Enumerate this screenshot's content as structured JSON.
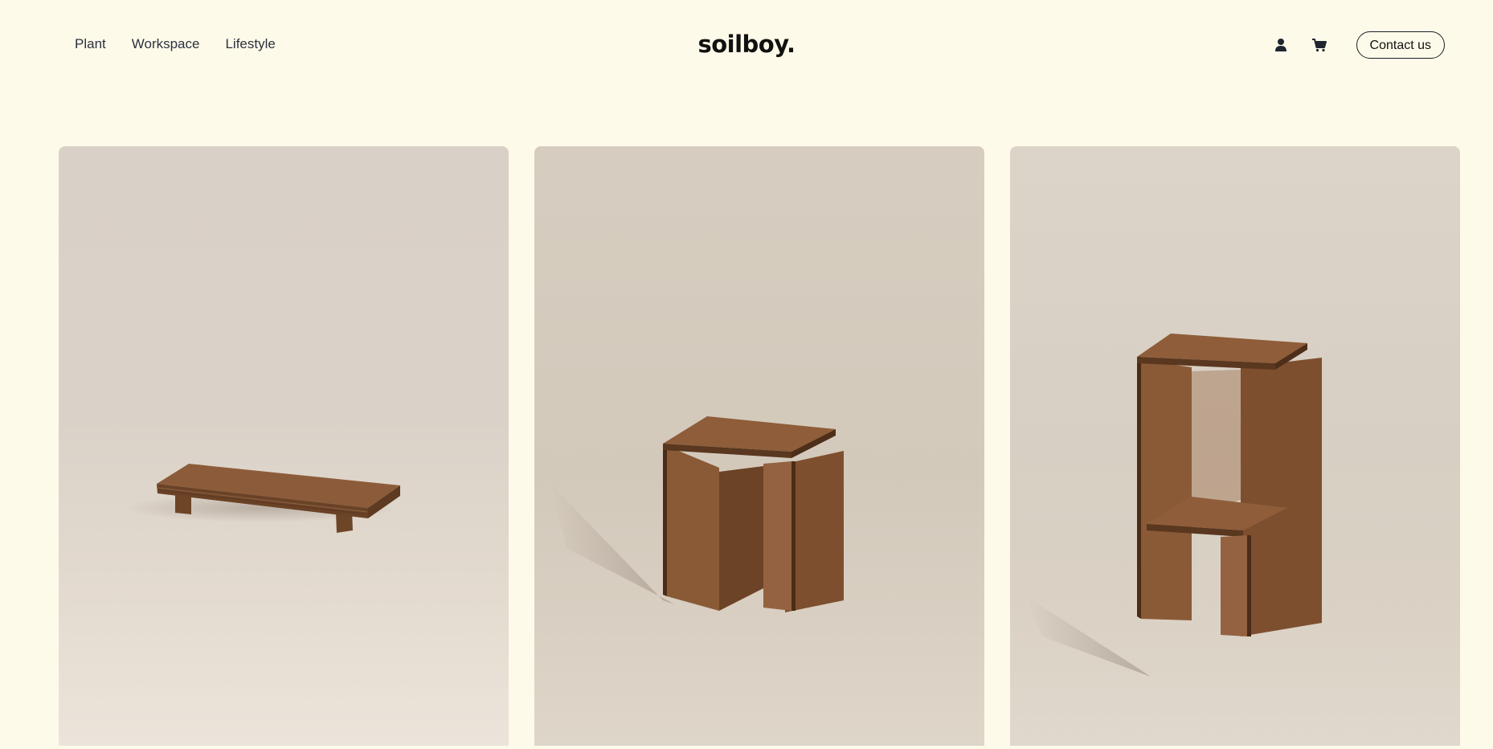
{
  "nav": {
    "items": [
      {
        "label": "Plant"
      },
      {
        "label": "Workspace"
      },
      {
        "label": "Lifestyle"
      }
    ]
  },
  "brand": {
    "logo": "soilboy."
  },
  "header_actions": {
    "account_icon": "user-icon",
    "cart_icon": "cart-icon",
    "contact_label": "Contact us"
  },
  "products": [
    {
      "image": "low-wooden-plant-stand",
      "alt_icon": "wooden-riser-image"
    },
    {
      "image": "wooden-side-stool",
      "alt_icon": "wooden-stool-image"
    },
    {
      "image": "two-tier-wooden-stand",
      "alt_icon": "wooden-tall-stand-image"
    }
  ],
  "colors": {
    "background": "#fefae9",
    "wood": "#8a5a3a",
    "text": "#1f2630"
  }
}
